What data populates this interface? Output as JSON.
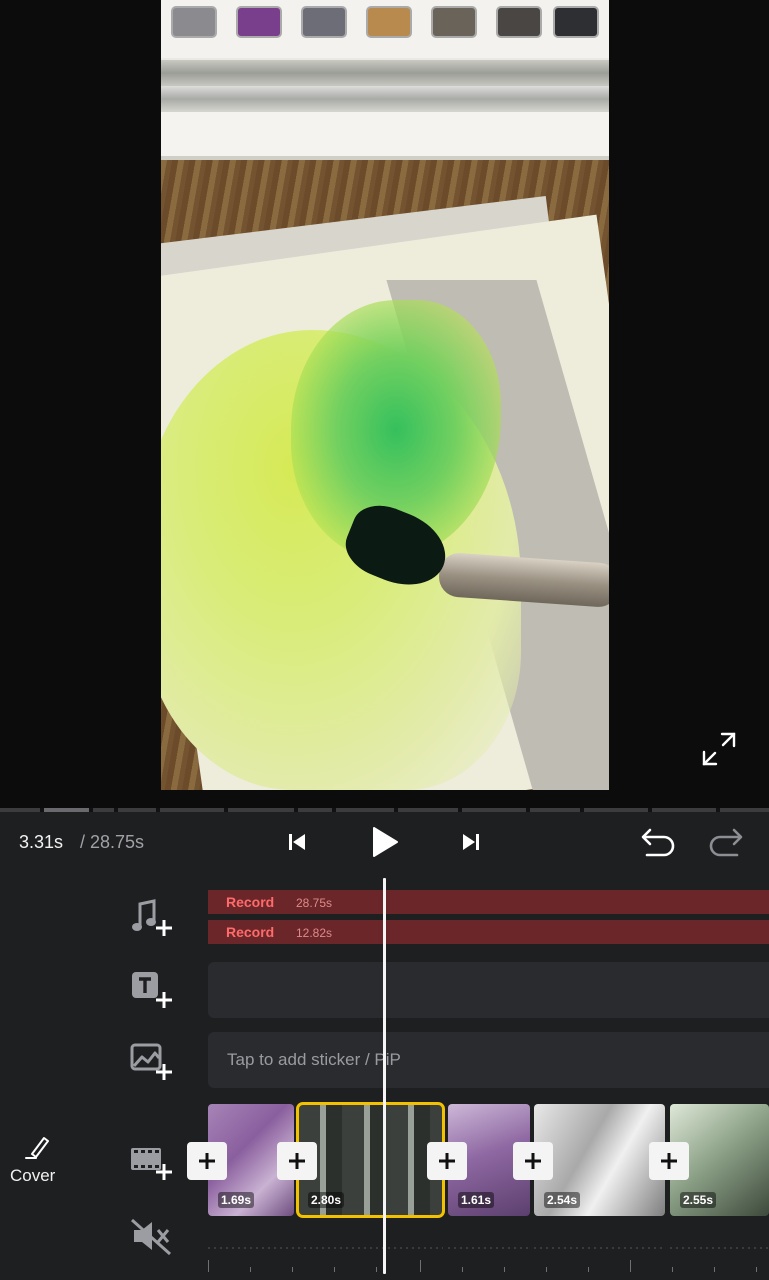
{
  "preview": {
    "fullscreen_icon": "expand-arrows-icon"
  },
  "controls": {
    "current_time": "3.31s",
    "total_time": "/ 28.75s",
    "icons": [
      "skip-previous-icon",
      "play-icon",
      "skip-next-icon",
      "undo-icon",
      "redo-icon"
    ]
  },
  "timeline": {
    "audio_tracks": [
      {
        "name": "Record",
        "duration": "28.75s"
      },
      {
        "name": "Record",
        "duration": "12.82s"
      }
    ],
    "sticker_hint": "Tap to add sticker / PiP",
    "cover_label": "Cover",
    "clips": [
      {
        "duration": "1.69s"
      },
      {
        "duration": "2.80s"
      },
      {
        "duration": "1.61s"
      },
      {
        "duration": "2.54s"
      },
      {
        "duration": "2.55s"
      }
    ],
    "track_icons": [
      "add-music-icon",
      "add-text-icon",
      "add-sticker-icon",
      "add-clip-icon",
      "mute-icon"
    ]
  },
  "colors": {
    "background": "#1e1f21",
    "audio_track": "#6a2628",
    "audio_text": "#ff6b6b",
    "selected_clip": "#f2c200"
  }
}
